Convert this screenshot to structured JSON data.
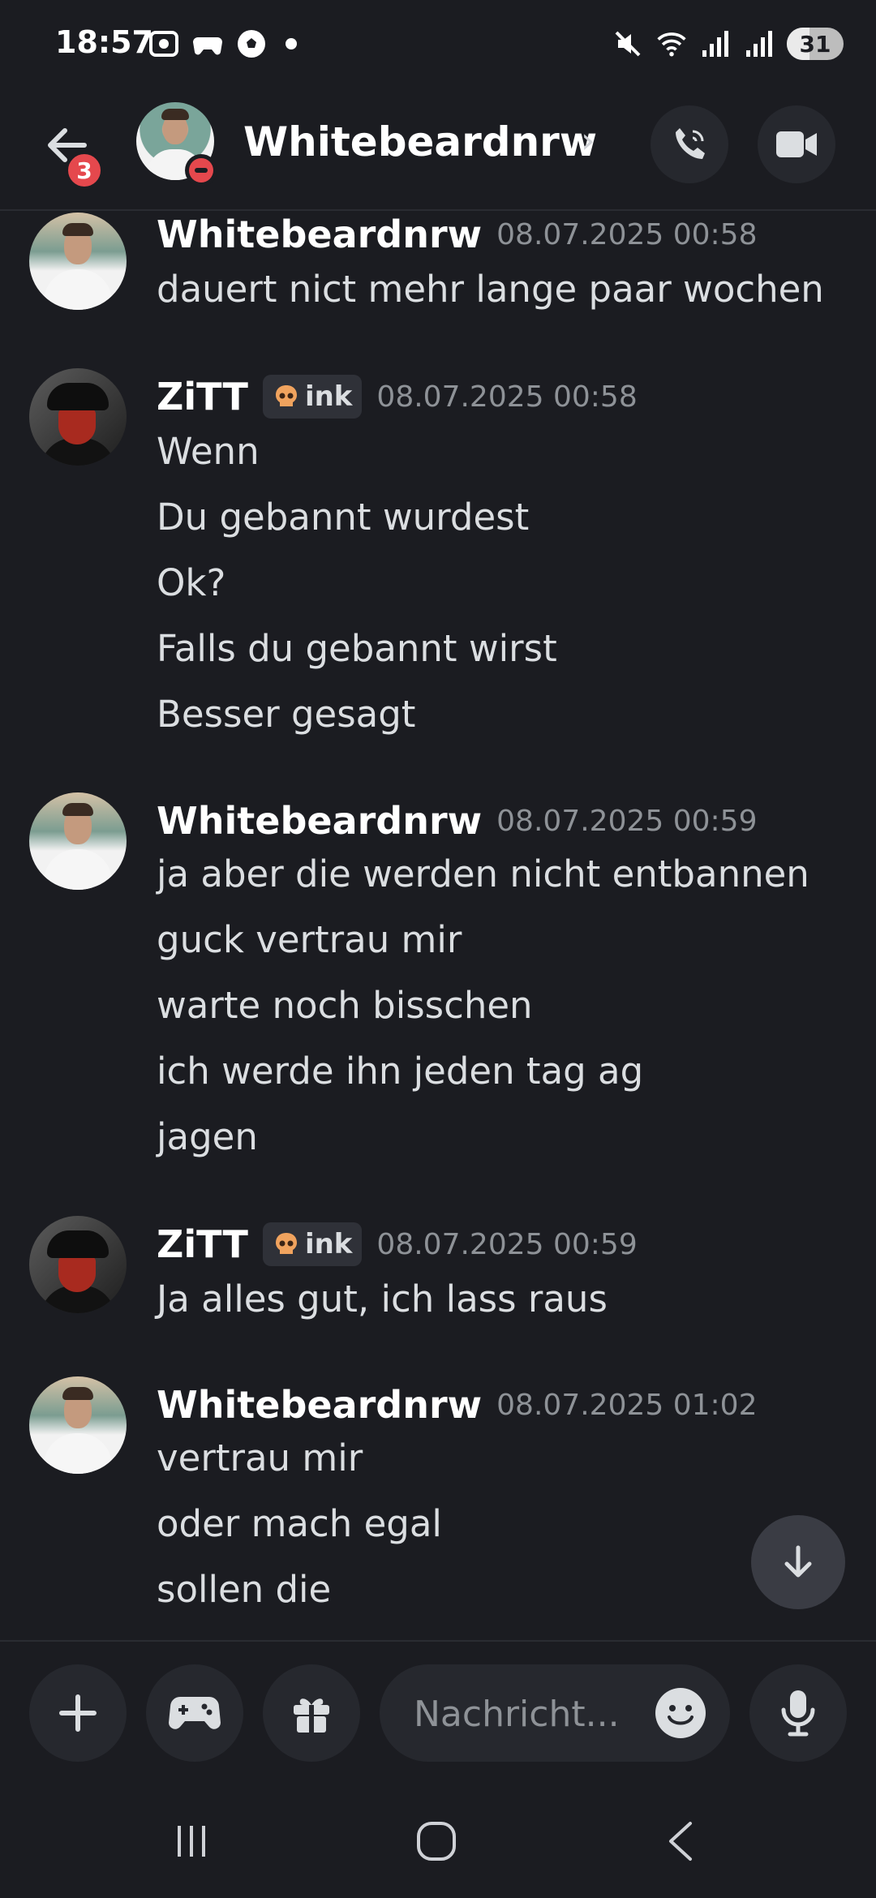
{
  "status_bar": {
    "time": "18:57",
    "left_icons": [
      "screenshot-icon",
      "game-controller-icon",
      "soccer-ball-icon",
      "notification-dot"
    ],
    "right_icons": [
      "mute-icon",
      "wifi-icon",
      "signal-icon",
      "signal-icon"
    ],
    "battery": "31"
  },
  "header": {
    "back_badge": "3",
    "channel_name": "Whitebeardnrw",
    "chevron": "›",
    "actions": [
      "voice-call",
      "video-call"
    ]
  },
  "messages": [
    {
      "author": "Whitebeardnrw",
      "timestamp": "08.07.2025 00:58",
      "lines": [
        "dauert nict mehr lange paar wochen"
      ]
    },
    {
      "author": "ZiTT",
      "tag": "ink",
      "timestamp": "08.07.2025 00:58",
      "lines": [
        "Wenn",
        "Du gebannt wurdest",
        "Ok?",
        "Falls du gebannt wirst",
        "Besser gesagt"
      ]
    },
    {
      "author": "Whitebeardnrw",
      "timestamp": "08.07.2025 00:59",
      "lines": [
        "ja aber die werden nicht entbannen",
        "guck vertrau mir",
        "warte noch bisschen",
        "ich werde ihn jeden tag ag",
        "jagen"
      ]
    },
    {
      "author": "ZiTT",
      "tag": "ink",
      "timestamp": "08.07.2025 00:59",
      "lines": [
        "Ja alles gut, ich lass raus"
      ]
    },
    {
      "author": "Whitebeardnrw",
      "timestamp": "08.07.2025 01:02",
      "lines": [
        "vertrau mir",
        "oder mach egal",
        "sollen die"
      ]
    }
  ],
  "composer": {
    "placeholder": "Nachricht..."
  },
  "colors": {
    "background": "#1b1c21",
    "surface": "#26282e",
    "badge_red": "#e5484d",
    "muted_text": "#8e9297"
  }
}
